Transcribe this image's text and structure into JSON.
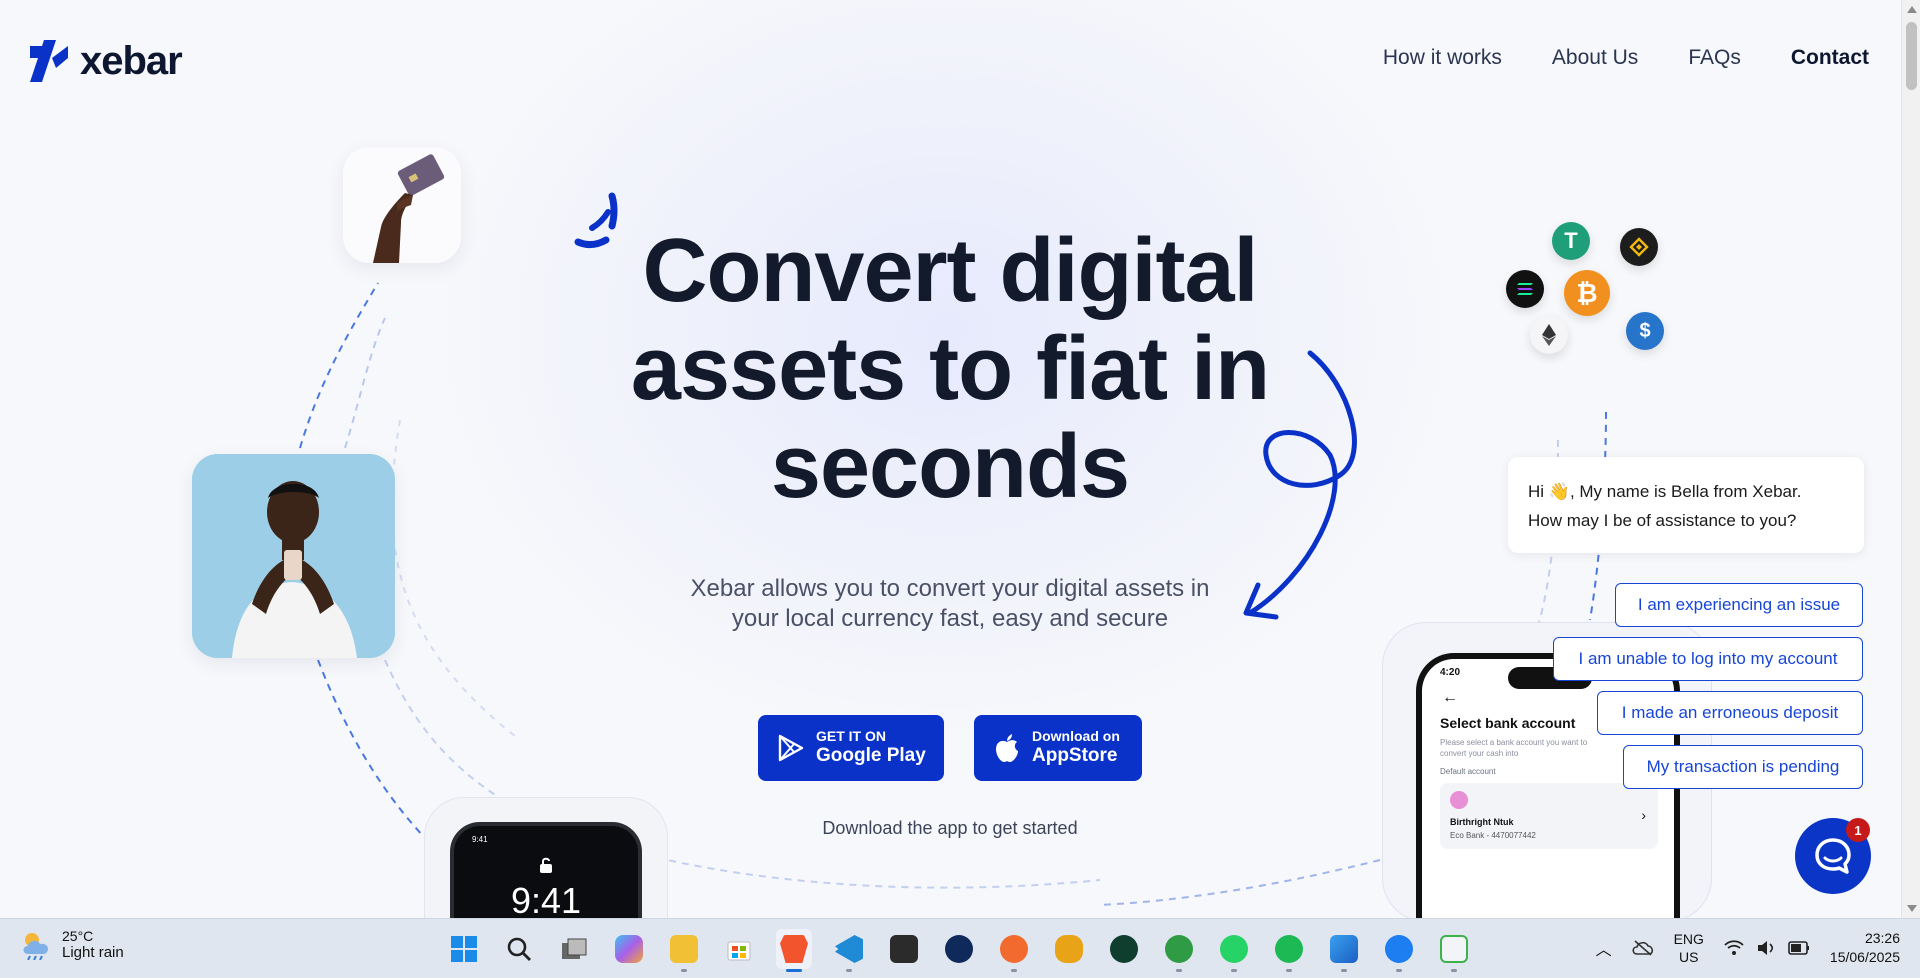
{
  "header": {
    "logo_text": "xebar",
    "nav": [
      {
        "label": "How it works"
      },
      {
        "label": "About Us"
      },
      {
        "label": "FAQs"
      },
      {
        "label": "Contact"
      }
    ]
  },
  "hero": {
    "title_line1": "Convert digital",
    "title_line2": "assets to fiat in",
    "title_line3": "seconds",
    "subtitle_line1": "Xebar allows you to convert your digital assets in",
    "subtitle_line2": "your local currency fast, easy and secure",
    "google_small": "GET IT ON",
    "google_big": "Google Play",
    "apple_small": "Download on",
    "apple_big": "AppStore",
    "caption": "Download the app to get started"
  },
  "phone_left": {
    "status_time": "9:41",
    "time": "9:41"
  },
  "phone_right": {
    "status_time": "4:20",
    "title": "Select bank account",
    "description": "Please select a bank account you want to convert your cash into",
    "label": "Default account",
    "account_name": "Birthright Ntuk",
    "account_number": "Eco Bank - 4470077442"
  },
  "crypto_coins": [
    "tether-icon",
    "binance-icon",
    "solana-icon",
    "bitcoin-icon",
    "ethereum-icon",
    "usdc-icon"
  ],
  "chat": {
    "greeting_line1": "Hi 👋, My name is Bella from Xebar.",
    "greeting_line2": "How may I be of assistance to you?",
    "options": [
      "I am experiencing an issue",
      "I am unable to log into my account",
      "I made an erroneous deposit",
      "My transaction is pending"
    ],
    "badge": "1"
  },
  "colors": {
    "brand_blue": "#0a32c8",
    "title": "#121a2c",
    "badge_red": "#c61a1a"
  },
  "taskbar": {
    "weather_temp": "25°C",
    "weather_desc": "Light rain",
    "lang_line1": "ENG",
    "lang_line2": "US",
    "time": "23:26",
    "date": "15/06/2025",
    "apps": [
      "start-icon",
      "search-icon",
      "task-view-icon",
      "copilot-icon",
      "file-explorer-icon",
      "ms-store-icon",
      "brave-browser-icon",
      "vscode-icon",
      "terminal-icon",
      "app-blue-icon",
      "app-orange-icon",
      "app-yellow-icon",
      "mongodb-icon",
      "app-green-icon",
      "whatsapp-icon",
      "spotify-icon",
      "photos-icon",
      "app-store-icon",
      "android-icon"
    ]
  }
}
